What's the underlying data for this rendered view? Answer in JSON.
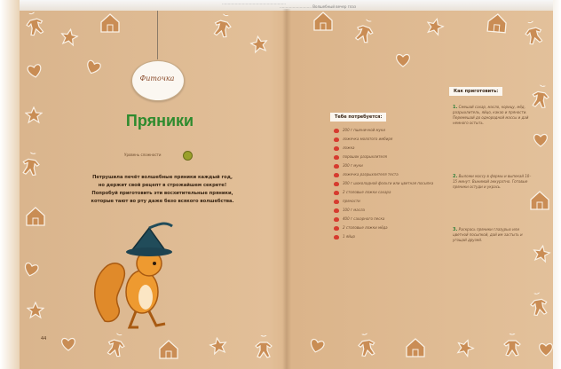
{
  "header_strip": {
    "line1": "………………………………………………",
    "line2": "……………………… Волшебный вечер глаз"
  },
  "left_page": {
    "label": "Фиточка",
    "title": "Пряники",
    "difficulty": "Уровень сложности",
    "intro": [
      "Петрушила печёт волшебные пряники каждый год,",
      "но держит свой рецепт в строжайшем секрете!",
      "Попробуй приготовить эти восхитительные пряники,",
      "которые тают во рту даже безо всякого волшебства."
    ],
    "page_number": "44"
  },
  "right_page": {
    "ingredients_title": "Тебе потребуется:",
    "ingredients": [
      "200 г пшеничной муки",
      "ложечка молотого имбиря",
      "ложка",
      "порошок разрыхлителя",
      "300 г муки",
      "ложечка разрыхлителя теста",
      "300 г шоколадной фольги или цветная посыпка",
      "2 столовые ложки сахара",
      "пряности",
      "100 г масла",
      "400 г сахарного песка",
      "2 столовые ложки мёда",
      "1 яйцо"
    ],
    "method_title": "Как приготовить:",
    "steps": [
      {
        "num": "1.",
        "text": "Смешай сахар, масло, корицу, мёд, разрыхлитель, яйцо, какао и пряности. Перемешай до однородной массы и дай немного остыть."
      },
      {
        "num": "2.",
        "text": "Выложи массу в формы и выпекай 10–15 минут. Вынимай аккуратно. Готовые пряники остуди и укрась."
      },
      {
        "num": "3.",
        "text": "Раскрась пряники глазурью или цветной посыпкой, дай им застыть и угощай друзей."
      }
    ]
  },
  "icons": [
    "gingerbread-man-icon",
    "gingerbread-house-icon",
    "heart-cookie-icon",
    "star-cookie-icon",
    "squirrel-witch-illustration",
    "mushroom-bullet-icon",
    "difficulty-level-icon"
  ],
  "colors": {
    "title_green": "#2e8b2e",
    "bullet_red": "#d63b2f",
    "paper": "#e2bf98"
  }
}
